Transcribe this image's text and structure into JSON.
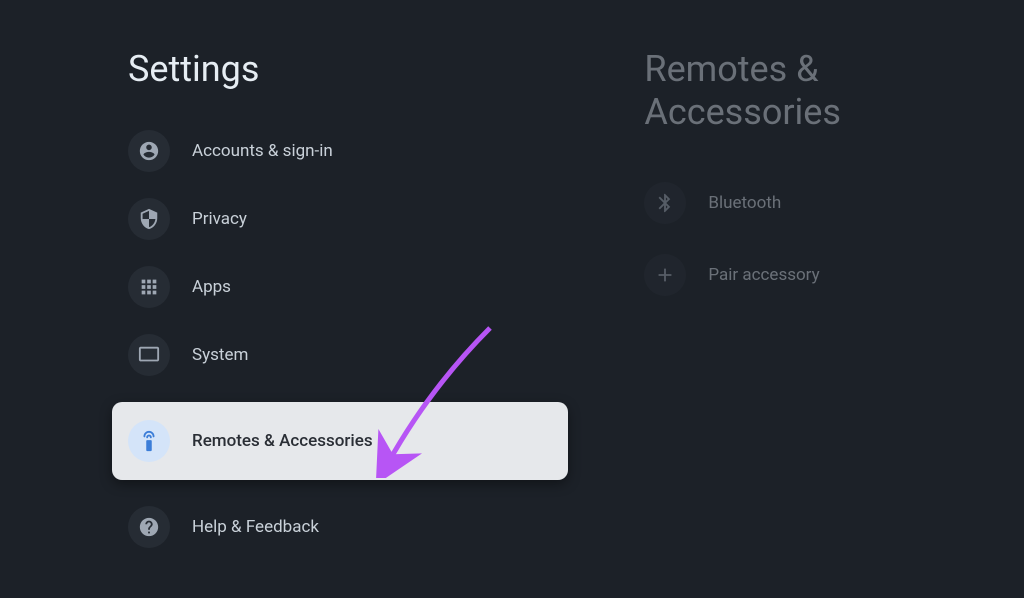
{
  "settings": {
    "title": "Settings",
    "items": [
      {
        "label": "Accounts & sign-in",
        "icon": "account",
        "selected": false
      },
      {
        "label": "Privacy",
        "icon": "shield",
        "selected": false
      },
      {
        "label": "Apps",
        "icon": "apps",
        "selected": false
      },
      {
        "label": "System",
        "icon": "monitor",
        "selected": false
      },
      {
        "label": "Remotes & Accessories",
        "icon": "remote",
        "selected": true
      },
      {
        "label": "Help & Feedback",
        "icon": "help",
        "selected": false
      }
    ]
  },
  "detail": {
    "title": "Remotes & Accessories",
    "items": [
      {
        "label": "Bluetooth",
        "icon": "bluetooth"
      },
      {
        "label": "Pair accessory",
        "icon": "plus"
      }
    ]
  }
}
